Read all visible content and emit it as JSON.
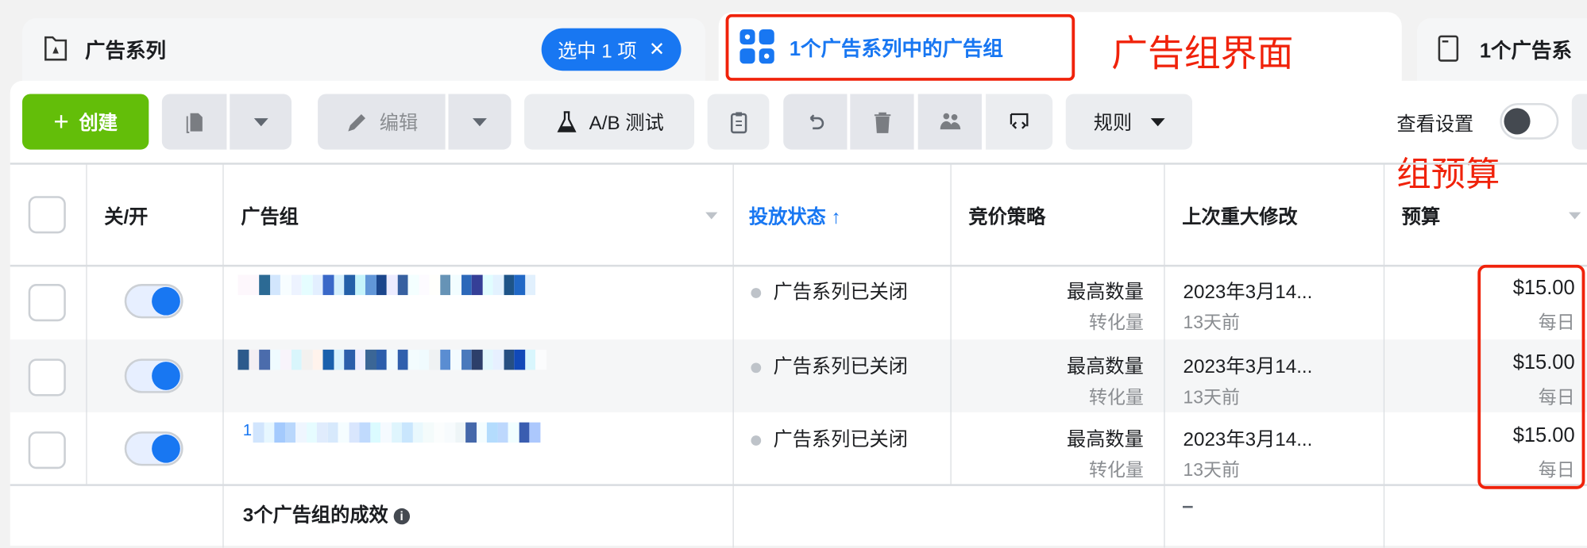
{
  "tabs": [
    {
      "label": "广告系列",
      "badge": "选中 1 项"
    },
    {
      "label": "1个广告系列中的广告组"
    },
    {
      "label": "1个广告系"
    }
  ],
  "annotations": {
    "adset_ui": "广告组界面",
    "adset_budget": "组预算"
  },
  "toolbar": {
    "create": "创建",
    "edit": "编辑",
    "ab_test": "A/B 测试",
    "rules": "规则",
    "view_settings": "查看设置"
  },
  "table": {
    "headers": {
      "toggle": "关/开",
      "adset": "广告组",
      "delivery": "投放状态 ↑",
      "bid": "竞价策略",
      "last_edit": "上次重大修改",
      "budget": "预算"
    },
    "rows": [
      {
        "name_prefix": "",
        "delivery": "广告系列已关闭",
        "bid": "最高数量",
        "bid_sub": "转化量",
        "last_edit": "2023年3月14...",
        "last_edit_sub": "13天前",
        "budget": "$15.00",
        "budget_sub": "每日",
        "on": true
      },
      {
        "name_prefix": "",
        "delivery": "广告系列已关闭",
        "bid": "最高数量",
        "bid_sub": "转化量",
        "last_edit": "2023年3月14...",
        "last_edit_sub": "13天前",
        "budget": "$15.00",
        "budget_sub": "每日",
        "on": true
      },
      {
        "name_prefix": "1",
        "delivery": "广告系列已关闭",
        "bid": "最高数量",
        "bid_sub": "转化量",
        "last_edit": "2023年3月14...",
        "last_edit_sub": "13天前",
        "budget": "$15.00",
        "budget_sub": "每日",
        "on": true
      }
    ],
    "summary": {
      "label": "3个广告组的成效",
      "last_edit": "–"
    }
  }
}
